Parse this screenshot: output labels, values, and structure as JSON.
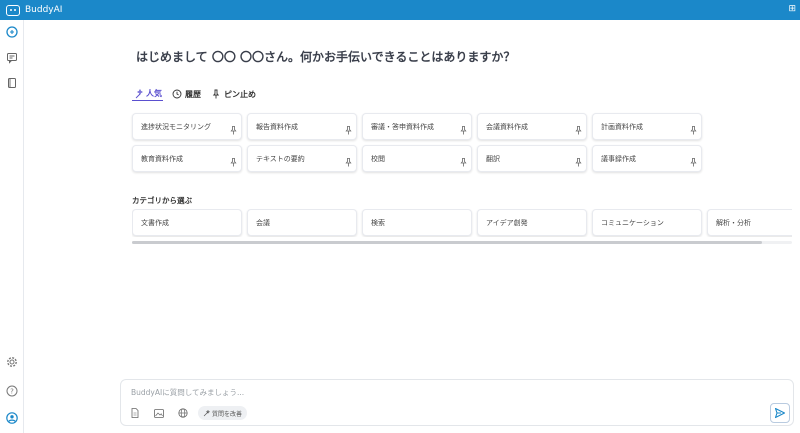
{
  "app": {
    "title": "BuddyAI"
  },
  "greeting": "はじめまして 〇〇 〇〇さん。何かお手伝いできることはありますか？",
  "tabs": [
    {
      "label": "人気",
      "icon": "sparkle-icon",
      "active": true
    },
    {
      "label": "履歴",
      "icon": "history-icon",
      "active": false
    },
    {
      "label": "ピン止め",
      "icon": "pin-icon",
      "active": false
    }
  ],
  "prompts": [
    "進捗状況モニタリング",
    "報告資料作成",
    "審議・答申資料作成",
    "会議資料作成",
    "計画資料作成",
    "教育資料作成",
    "テキストの要約",
    "校閲",
    "翻訳",
    "議事録作成"
  ],
  "category_section_label": "カテゴリから選ぶ",
  "categories": [
    "文書作成",
    "会議",
    "検索",
    "アイデア創発",
    "コミュニケーション",
    "解析・分析"
  ],
  "composer": {
    "placeholder": "BuddyAIに質問してみましょう...",
    "improve_label": "質問を改善"
  },
  "colors": {
    "brand": "#1b88c9",
    "accent": "#5a4fcf"
  }
}
